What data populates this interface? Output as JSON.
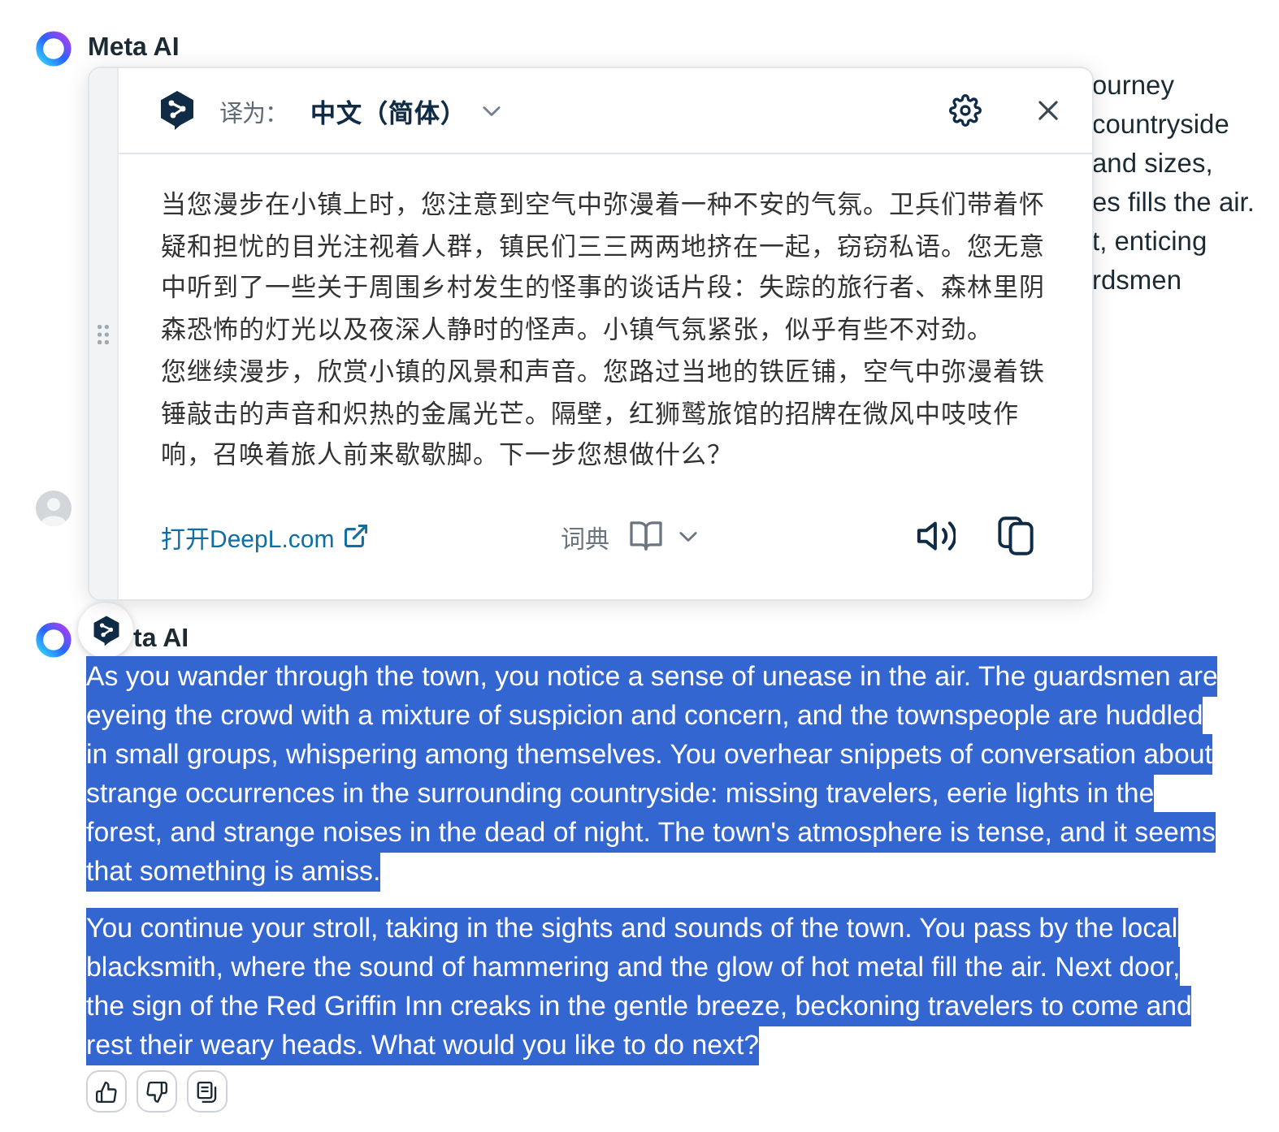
{
  "conversation": [
    {
      "kind": "assistant",
      "sender": "Meta AI",
      "lines": [
        "ourney",
        "countryside",
        "and sizes,",
        "es fills the air.",
        "t, enticing",
        "rdsmen"
      ]
    },
    {
      "kind": "user"
    },
    {
      "kind": "assistant",
      "sender": "ta AI",
      "paragraphs": [
        {
          "text": "As you wander through the town, you notice a sense of unease in the air. The guardsmen are eyeing the crowd with a mixture of suspicion and concern, and the townspeople are huddled in small groups, whispering among themselves. You overhear snippets of conversation about strange occurrences in the surrounding countryside: missing travelers, eerie lights in the forest, and strange noises in the dead of night. The town's atmosphere is tense, and it seems that something is amiss.",
          "selected": true
        },
        {
          "text": "You continue your stroll, taking in the sights and sounds of the town. You pass by the local blacksmith, where the sound of hammering and the glow of hot metal fill the air. Next door, the sign of the Red Griffin Inn creaks in the gentle breeze, beckoning travelers to come and rest their weary heads. What would you like to do next?",
          "selected": true
        }
      ]
    }
  ],
  "translator_popup": {
    "target_label": "译为：",
    "language": "中文（简体）",
    "paragraphs": [
      "当您漫步在小镇上时，您注意到空气中弥漫着一种不安的气氛。卫兵们带着怀疑和担忧的目光注视着人群，镇民们三三两两地挤在一起，窃窃私语。您无意中听到了一些关于周围乡村发生的怪事的谈话片段：失踪的旅行者、森林里阴森恐怖的灯光以及夜深人静时的怪声。小镇气氛紧张，似乎有些不对劲。",
      "您继续漫步，欣赏小镇的风景和声音。您路过当地的铁匠铺，空气中弥漫着铁锤敲击的声音和炽热的金属光芒。隔壁，红狮鹫旅馆的招牌在微风中吱吱作响，召唤着旅人前来歇歇脚。下一步您想做什么？"
    ],
    "open_link": "打开DeepL.com",
    "dictionary_label": "词典"
  }
}
